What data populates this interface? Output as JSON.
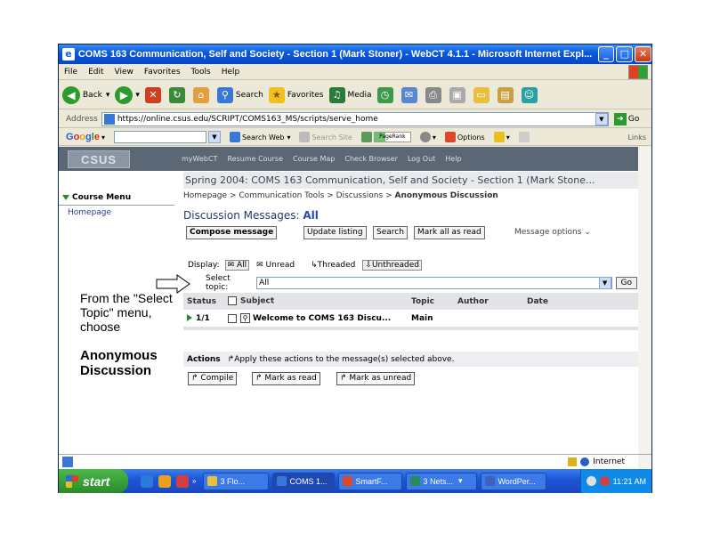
{
  "window": {
    "title": "COMS 163 Communication, Self and Society - Section 1 (Mark Stoner) - WebCT 4.1.1 - Microsoft Internet Expl..."
  },
  "menubar": [
    "File",
    "Edit",
    "View",
    "Favorites",
    "Tools",
    "Help"
  ],
  "toolbar": {
    "back": "Back",
    "search": "Search",
    "favorites": "Favorites",
    "media": "Media"
  },
  "address": {
    "label": "Address",
    "url": "https://online.csus.edu/SCRIPT/COMS163_MS/scripts/serve_home",
    "go": "Go"
  },
  "googlebar": {
    "search_web": "Search Web",
    "search_site": "Search Site",
    "pagerank": "PageRank",
    "options": "Options",
    "links": "Links"
  },
  "webct": {
    "logo": "CSUS",
    "nav": [
      "myWebCT",
      "Resume Course",
      "Course Map",
      "Check Browser",
      "Log Out",
      "Help"
    ],
    "course_title": "Spring 2004: COMS 163 Communication, Self and Society - Section 1 (Mark Stone...",
    "course_menu": "Course Menu",
    "sidebar_home": "Homepage",
    "breadcrumb": {
      "items": [
        "Homepage",
        "Communication Tools",
        "Discussions"
      ],
      "current": "Anonymous Discussion",
      "sep": ">"
    },
    "page_title_prefix": "Discussion Messages: ",
    "page_title_topic": "All",
    "buttons": {
      "compose": "Compose message",
      "update": "Update listing",
      "search": "Search",
      "mark_all": "Mark all as read"
    },
    "message_options": "Message options",
    "display": {
      "label": "Display:",
      "all": "All",
      "unread": "Unread",
      "threaded": "Threaded",
      "unthreaded": "Unthreaded"
    },
    "topic": {
      "label": "Select topic:",
      "value": "All",
      "go": "Go"
    },
    "table": {
      "headers": [
        "Status",
        "Subject",
        "Topic",
        "Author",
        "Date"
      ],
      "rows": [
        {
          "status": "1/1",
          "subject": "Welcome to COMS 163 Discu...",
          "topic": "Main",
          "author": "",
          "date": ""
        }
      ]
    },
    "actions": {
      "label": "Actions",
      "text": "Apply these actions to the message(s) selected above.",
      "compile": "Compile",
      "mark_read": "Mark as read",
      "mark_unread": "Mark as unread"
    }
  },
  "statusbar": {
    "zone": "Internet"
  },
  "taskbar": {
    "start": "start",
    "tasks": [
      "3 Flo...",
      "COMS 1...",
      "SmartF...",
      "3 Nets...",
      "WordPer..."
    ],
    "clock": "11:21 AM"
  },
  "instruction": {
    "line1": "From the \"Select Topic\" menu, choose",
    "line2": "Anonymous Discussion"
  },
  "colors": {
    "titlebar": "#0a5adc",
    "webct_header": "#5b6775",
    "accent_green": "#2a8a2a"
  }
}
